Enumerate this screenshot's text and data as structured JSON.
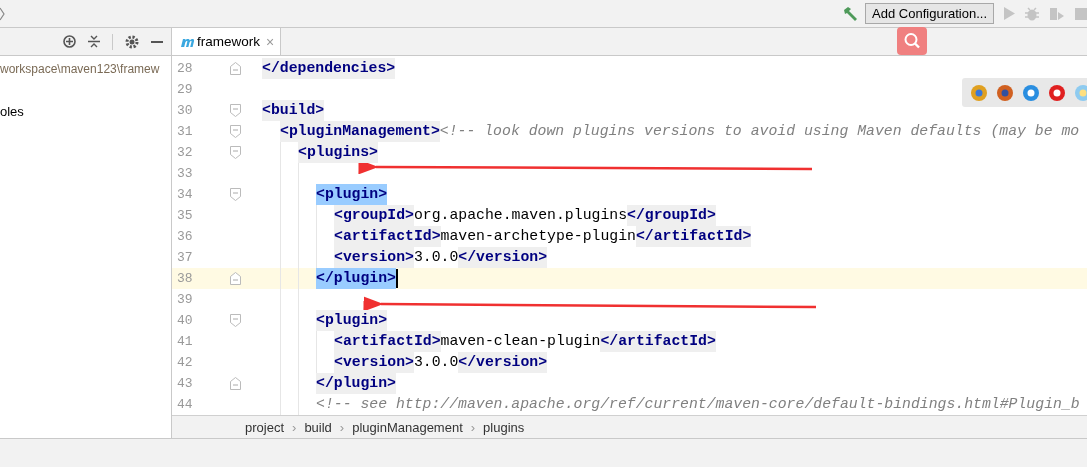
{
  "toolbar": {
    "run_config": "Add Configuration..."
  },
  "project_panel": {
    "path": "workspace\\maven123\\framew",
    "item": "oles"
  },
  "editor_tab": {
    "label": "framework",
    "selected": true,
    "close": "×"
  },
  "code_lines": [
    {
      "number": "28",
      "fold_start": false,
      "fold_end": true,
      "current": false,
      "segments": [
        {
          "kind": "tag",
          "text": "</dependencies>",
          "matched": false
        }
      ]
    },
    {
      "number": "29",
      "fold_start": false,
      "fold_end": false,
      "current": false
    },
    {
      "number": "30",
      "fold_start": true,
      "fold_end": false,
      "current": false,
      "segments": [
        {
          "kind": "tag",
          "text": "<build>",
          "matched": false
        }
      ],
      "children": [
        {
          "number": "31",
          "fold_start": true,
          "fold_end": false,
          "current": false,
          "segments": [
            {
              "kind": "tag",
              "text": "<pluginManagement>",
              "matched": false
            },
            {
              "kind": "comment",
              "text": "<!-- look down plugins versions to avoid using Maven defaults (may be mo"
            }
          ],
          "children": [
            {
              "number": "32",
              "fold_start": true,
              "fold_end": false,
              "current": false,
              "segments": [
                {
                  "kind": "tag",
                  "text": "<plugins>",
                  "matched": false
                }
              ],
              "children": [
                {
                  "number": "33",
                  "fold_start": false,
                  "fold_end": false,
                  "current": false
                },
                {
                  "number": "34",
                  "fold_start": true,
                  "fold_end": false,
                  "current": false,
                  "segments": [
                    {
                      "kind": "tag",
                      "text": "<plugin>",
                      "matched": true
                    }
                  ],
                  "children": [
                    {
                      "number": "35",
                      "fold_start": false,
                      "fold_end": false,
                      "current": false,
                      "segments": [
                        {
                          "kind": "tag",
                          "text": "<groupId>",
                          "matched": false
                        },
                        {
                          "kind": "text",
                          "text": "org.apache.maven.plugins"
                        },
                        {
                          "kind": "tag",
                          "text": "</groupId>",
                          "matched": false
                        }
                      ]
                    },
                    {
                      "number": "36",
                      "fold_start": false,
                      "fold_end": false,
                      "current": false,
                      "segments": [
                        {
                          "kind": "tag",
                          "text": "<artifactId>",
                          "matched": false
                        },
                        {
                          "kind": "text",
                          "text": "maven-archetype-plugin"
                        },
                        {
                          "kind": "tag",
                          "text": "</artifactId>",
                          "matched": false
                        }
                      ]
                    },
                    {
                      "number": "37",
                      "fold_start": false,
                      "fold_end": false,
                      "current": false,
                      "segments": [
                        {
                          "kind": "tag",
                          "text": "<version>",
                          "matched": false
                        },
                        {
                          "kind": "text",
                          "text": "3.0.0"
                        },
                        {
                          "kind": "tag",
                          "text": "</version>",
                          "matched": false
                        }
                      ]
                    }
                  ]
                },
                {
                  "number": "38",
                  "fold_start": false,
                  "fold_end": true,
                  "current": true,
                  "segments": [
                    {
                      "kind": "tag",
                      "text": "</plugin>",
                      "matched": true
                    }
                  ]
                },
                {
                  "number": "39",
                  "fold_start": false,
                  "fold_end": false,
                  "current": false
                },
                {
                  "number": "40",
                  "fold_start": true,
                  "fold_end": false,
                  "current": false,
                  "segments": [
                    {
                      "kind": "tag",
                      "text": "<plugin>",
                      "matched": false
                    }
                  ],
                  "children": [
                    {
                      "number": "41",
                      "fold_start": false,
                      "fold_end": false,
                      "current": false,
                      "segments": [
                        {
                          "kind": "tag",
                          "text": "<artifactId>",
                          "matched": false
                        },
                        {
                          "kind": "text",
                          "text": "maven-clean-plugin"
                        },
                        {
                          "kind": "tag",
                          "text": "</artifactId>",
                          "matched": false
                        }
                      ]
                    },
                    {
                      "number": "42",
                      "fold_start": false,
                      "fold_end": false,
                      "current": false,
                      "segments": [
                        {
                          "kind": "tag",
                          "text": "<version>",
                          "matched": false
                        },
                        {
                          "kind": "text",
                          "text": "3.0.0"
                        },
                        {
                          "kind": "tag",
                          "text": "</version>",
                          "matched": false
                        }
                      ]
                    }
                  ]
                },
                {
                  "number": "43",
                  "fold_start": false,
                  "fold_end": true,
                  "current": false,
                  "segments": [
                    {
                      "kind": "tag",
                      "text": "</plugin>",
                      "matched": false
                    }
                  ]
                },
                {
                  "number": "44",
                  "fold_start": false,
                  "fold_end": false,
                  "current": false,
                  "segments": [
                    {
                      "kind": "comment",
                      "text": "<!-- see http://maven.apache.org/ref/current/maven-core/default-bindings.html#Plugin_b"
                    }
                  ]
                }
              ]
            }
          ]
        }
      ]
    }
  ],
  "breadcrumbs": [
    {
      "label": "project",
      "separator": "›"
    },
    {
      "label": "build",
      "separator": "›"
    },
    {
      "label": "pluginManagement",
      "separator": "›"
    },
    {
      "label": "plugins"
    }
  ]
}
